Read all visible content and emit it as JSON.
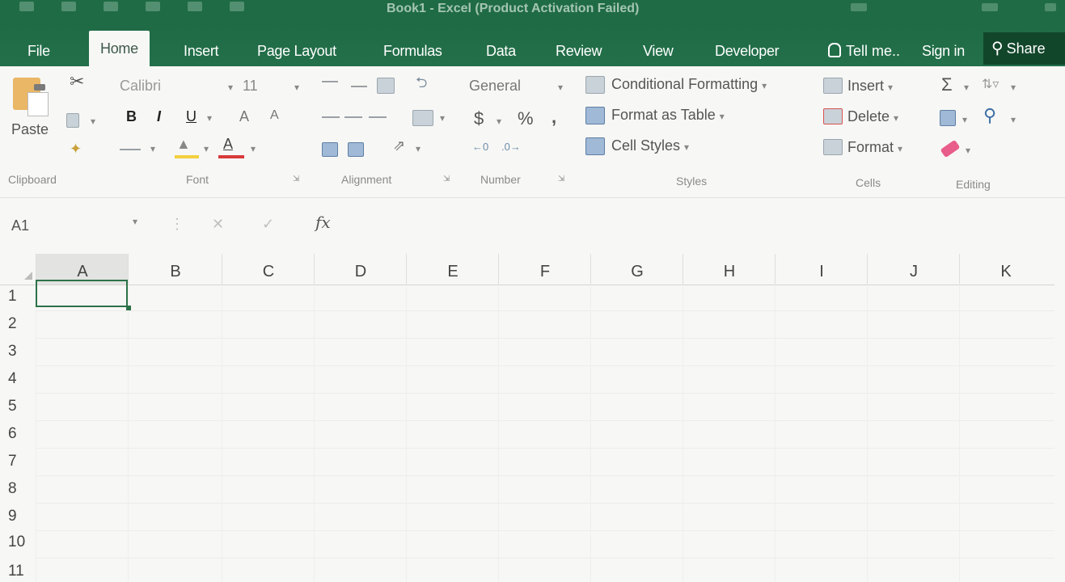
{
  "window": {
    "title": "Book1 - Excel (Product Activation Failed)"
  },
  "tabs": [
    "File",
    "Home",
    "Insert",
    "Page Layout",
    "Formulas",
    "Data",
    "Review",
    "View",
    "Developer"
  ],
  "active_tab": "Home",
  "header": {
    "tell_me": "Tell me..",
    "sign_in": "Sign in",
    "share": "Share"
  },
  "ribbon": {
    "clipboard": {
      "paste_label": "Paste",
      "group_label": "Clipboard"
    },
    "font": {
      "font_name": "Calibri",
      "font_size": "11",
      "bold": "B",
      "italic": "I",
      "underline": "U",
      "increase_font": "A",
      "decrease_font": "A",
      "font_color_letter": "A",
      "group_label": "Font"
    },
    "alignment": {
      "group_label": "Alignment"
    },
    "number": {
      "format": "General",
      "currency": "$",
      "percent": "%",
      "comma": ",",
      "group_label": "Number"
    },
    "styles": {
      "conditional_formatting": "Conditional Formatting",
      "format_as_table": "Format as Table",
      "cell_styles": "Cell Styles",
      "group_label": "Styles"
    },
    "cells": {
      "insert": "Insert",
      "delete": "Delete",
      "format": "Format",
      "group_label": "Cells"
    },
    "editing": {
      "autosum": "Σ",
      "group_label": "Editing"
    }
  },
  "formula_bar": {
    "name_box": "A1",
    "fx": "fx",
    "value": ""
  },
  "sheet": {
    "columns": [
      "A",
      "B",
      "C",
      "D",
      "E",
      "F",
      "G",
      "H",
      "I",
      "J",
      "K"
    ],
    "rows": [
      "1",
      "2",
      "3",
      "4",
      "5",
      "6",
      "7",
      "8",
      "9",
      "10",
      "11"
    ],
    "selected_cell": "A1"
  },
  "colors": {
    "title_green": "#1f6b45",
    "share_dark": "#12462b",
    "selection_border": "#2d7248",
    "font_color_red": "#d93a3a",
    "fill_color_yellow": "#f2d040"
  }
}
